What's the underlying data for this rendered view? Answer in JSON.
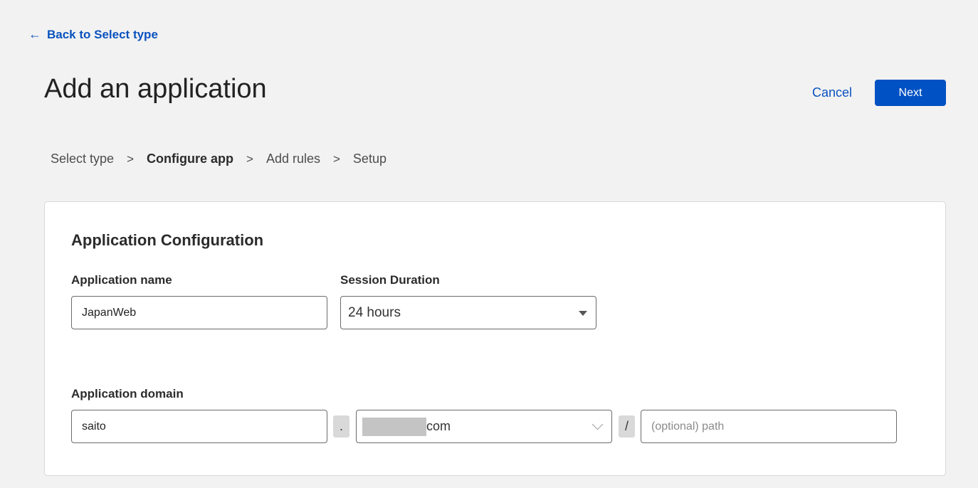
{
  "nav": {
    "back_arrow": "←",
    "back_label": "Back to Select type"
  },
  "header": {
    "title": "Add an application",
    "cancel_label": "Cancel",
    "next_label": "Next"
  },
  "breadcrumb": {
    "steps": [
      "Select type",
      "Configure app",
      "Add rules",
      "Setup"
    ],
    "separator": ">",
    "current_index": 1
  },
  "card": {
    "title": "Application Configuration",
    "app_name": {
      "label": "Application name",
      "value": "JapanWeb"
    },
    "session_duration": {
      "label": "Session Duration",
      "value": "24 hours"
    },
    "app_domain": {
      "label": "Application domain",
      "subdomain_value": "saito",
      "dot": ".",
      "domain_suffix": "com",
      "slash": "/",
      "path_placeholder": "(optional) path"
    }
  },
  "colors": {
    "accent": "#0051c3",
    "link": "#0a52bf",
    "background": "#f2f2f2"
  },
  "icons": {
    "back": "arrow-left-icon",
    "session_dropdown": "caret-down-icon",
    "domain_dropdown": "chevron-down-icon"
  }
}
